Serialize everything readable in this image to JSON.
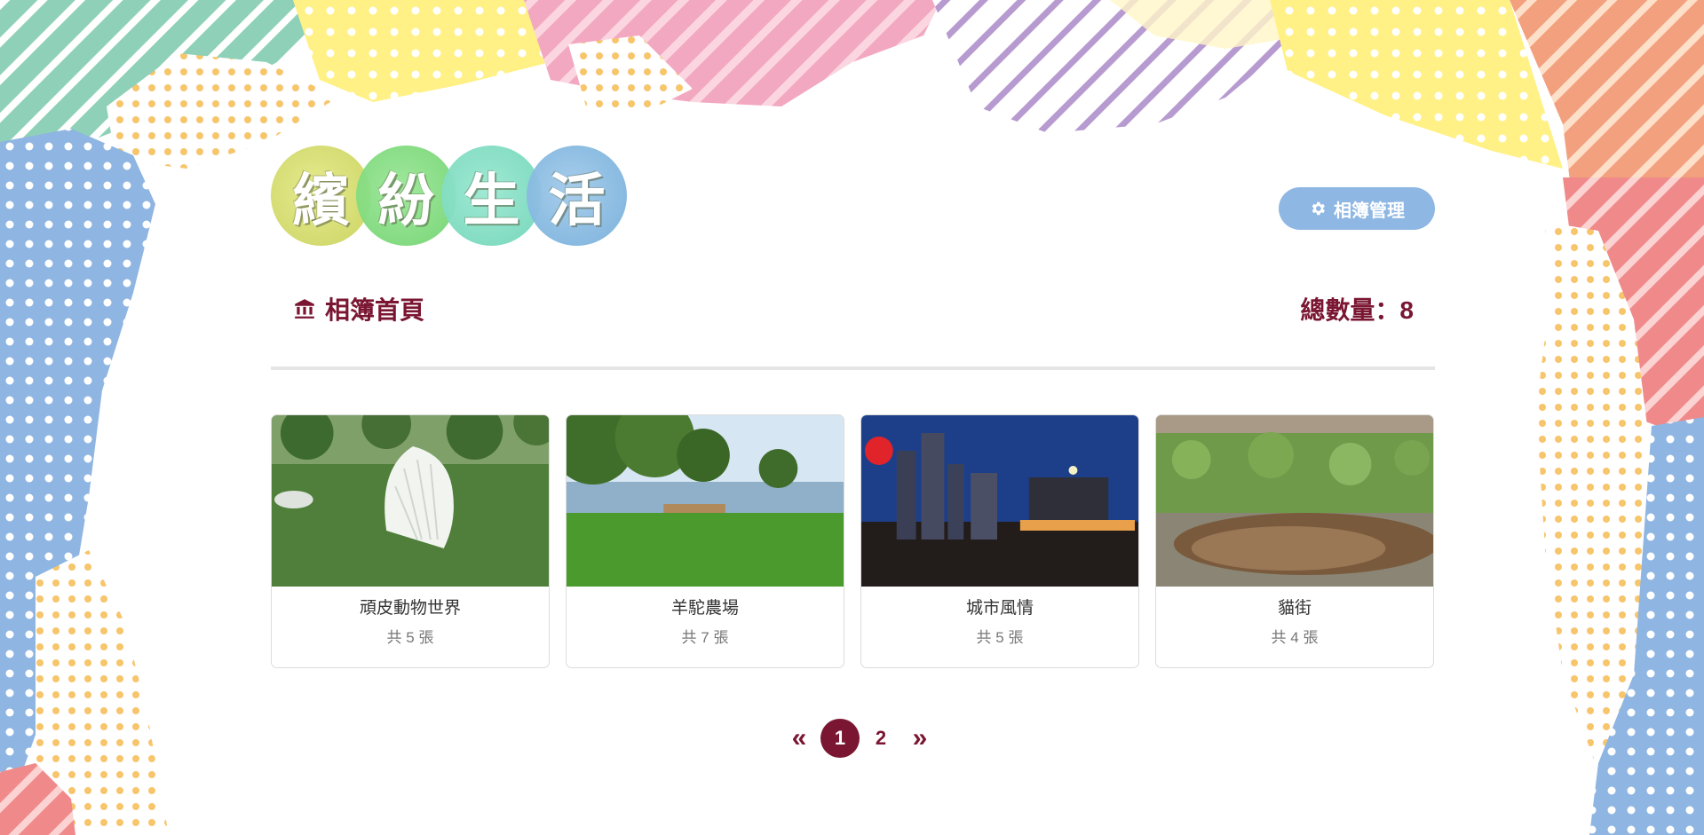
{
  "logo": {
    "characters": [
      "繽",
      "紛",
      "生",
      "活"
    ],
    "colors": [
      "#d2d95a",
      "#7fdc7a",
      "#76dcc0",
      "#7fb4de"
    ]
  },
  "header": {
    "manage_label": "相簿管理",
    "manage_icon": "gear-icon"
  },
  "breadcrumb": {
    "label": "相簿首頁",
    "icon": "bank-icon"
  },
  "total": {
    "text": "總數量：8"
  },
  "albums": [
    {
      "title": "頑皮動物世界",
      "count": "共 5 張"
    },
    {
      "title": "羊駝農場",
      "count": "共 7 張"
    },
    {
      "title": "城市風情",
      "count": "共 5 張"
    },
    {
      "title": "貓街",
      "count": "共 4 張"
    }
  ],
  "pagination": {
    "prev": "«",
    "pages": [
      "1",
      "2"
    ],
    "active": "1",
    "next": "»"
  },
  "colors": {
    "accent": "#7a1632",
    "button": "#8eb7e3",
    "divider": "#e5e5e5"
  }
}
